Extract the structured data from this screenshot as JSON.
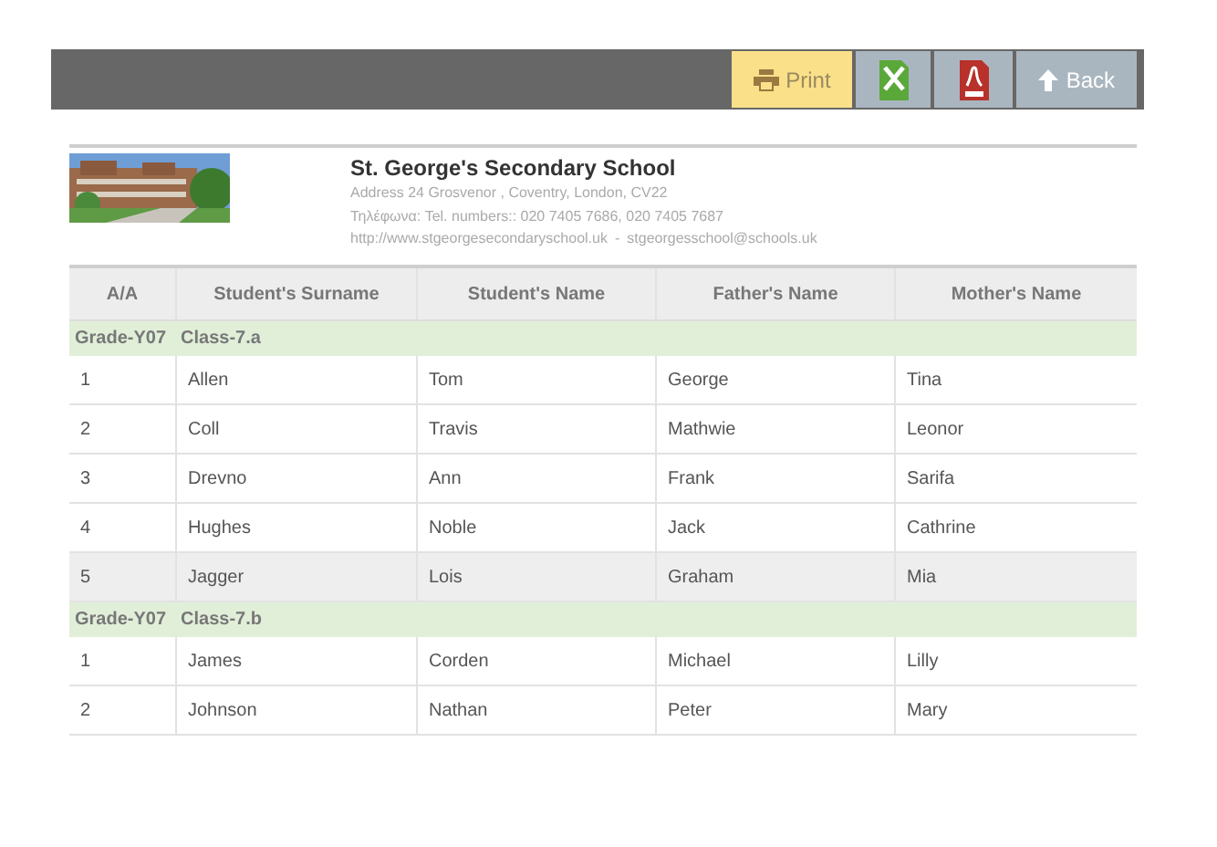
{
  "toolbar": {
    "buttons": [
      {
        "kind": "print",
        "label": "Print"
      },
      {
        "kind": "excel"
      },
      {
        "kind": "pdf"
      },
      {
        "kind": "back",
        "label": "Back"
      }
    ]
  },
  "school": {
    "kind": "picture",
    "name": "St. George's Secondary School",
    "address": "Address 24 Grosvenor , Coventry, London, CV22",
    "phones": "Τηλέφωνα: Tel. numbers:: 020 7405 7686, 020 7405 7687",
    "website": "http://www.stgeorgesecondaryschool.uk",
    "separator": "-",
    "email": "stgeorgesschool@schools.uk"
  },
  "table": {
    "columns": [
      "A/A",
      "Student's Surname",
      "Student's Name",
      "Father's Name",
      "Mother's Name"
    ],
    "groups": [
      {
        "grade": "Grade-Y07",
        "class": "Class-7.a",
        "rows": [
          {
            "cells": [
              "1",
              "Allen",
              "Tom",
              "George",
              "Tina"
            ],
            "selected": false
          },
          {
            "cells": [
              "2",
              "Coll",
              "Travis",
              "Mathwie",
              "Leonor"
            ],
            "selected": false
          },
          {
            "cells": [
              "3",
              "Drevno",
              "Ann",
              "Frank",
              "Sarifa"
            ],
            "selected": false
          },
          {
            "cells": [
              "4",
              "Hughes",
              "Noble",
              "Jack",
              "Cathrine"
            ],
            "selected": false
          },
          {
            "cells": [
              "5",
              "Jagger",
              "Lois",
              "Graham",
              "Mia"
            ],
            "selected": true
          }
        ]
      },
      {
        "grade": "Grade-Y07",
        "class": "Class-7.b",
        "rows": [
          {
            "cells": [
              "1",
              "James",
              "Corden",
              "Michael",
              "Lilly"
            ],
            "selected": false
          },
          {
            "cells": [
              "2",
              "Johnson",
              "Nathan",
              "Peter",
              "Mary"
            ],
            "selected": false
          }
        ]
      }
    ]
  }
}
